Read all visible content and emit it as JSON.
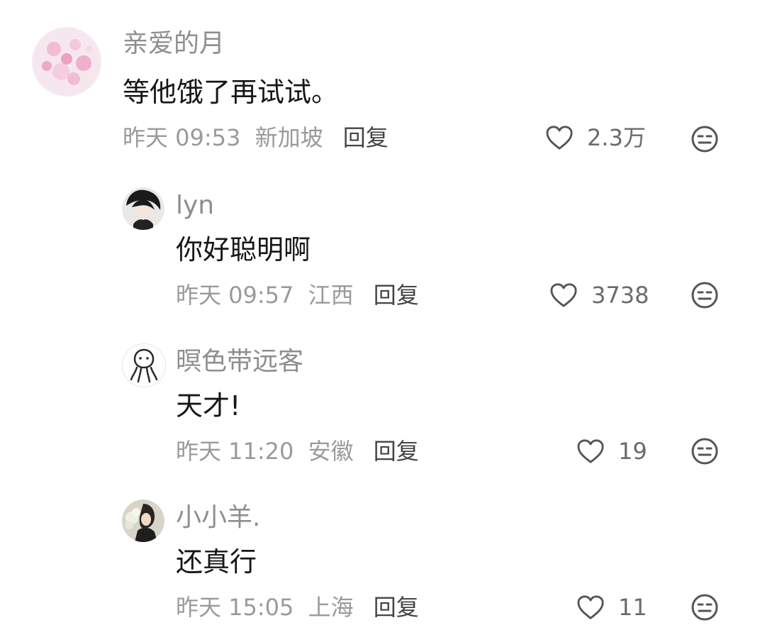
{
  "comments": [
    {
      "username": "亲爱的月",
      "text": "等他饿了再试试。",
      "time": "昨天 09:53",
      "location": "新加坡",
      "reply_label": "回复",
      "likes": "2.3万"
    },
    {
      "username": "lyn",
      "text": "你好聪明啊",
      "time": "昨天 09:57",
      "location": "江西",
      "reply_label": "回复",
      "likes": "3738"
    },
    {
      "username": "暝色带远客",
      "text": "天才!",
      "time": "昨天 11:20",
      "location": "安徽",
      "reply_label": "回复",
      "likes": "19"
    },
    {
      "username": "小小羊.",
      "text": "还真行",
      "time": "昨天 15:05",
      "location": "上海",
      "reply_label": "回复",
      "likes": "11"
    }
  ],
  "icons": {
    "like": "heart-outline-icon",
    "dislike": "neutral-face-icon"
  },
  "colors": {
    "username": "#8e8e8e",
    "content": "#161616",
    "meta": "#9a9a9a",
    "reply": "#444444",
    "icon_stroke": "#555555"
  }
}
